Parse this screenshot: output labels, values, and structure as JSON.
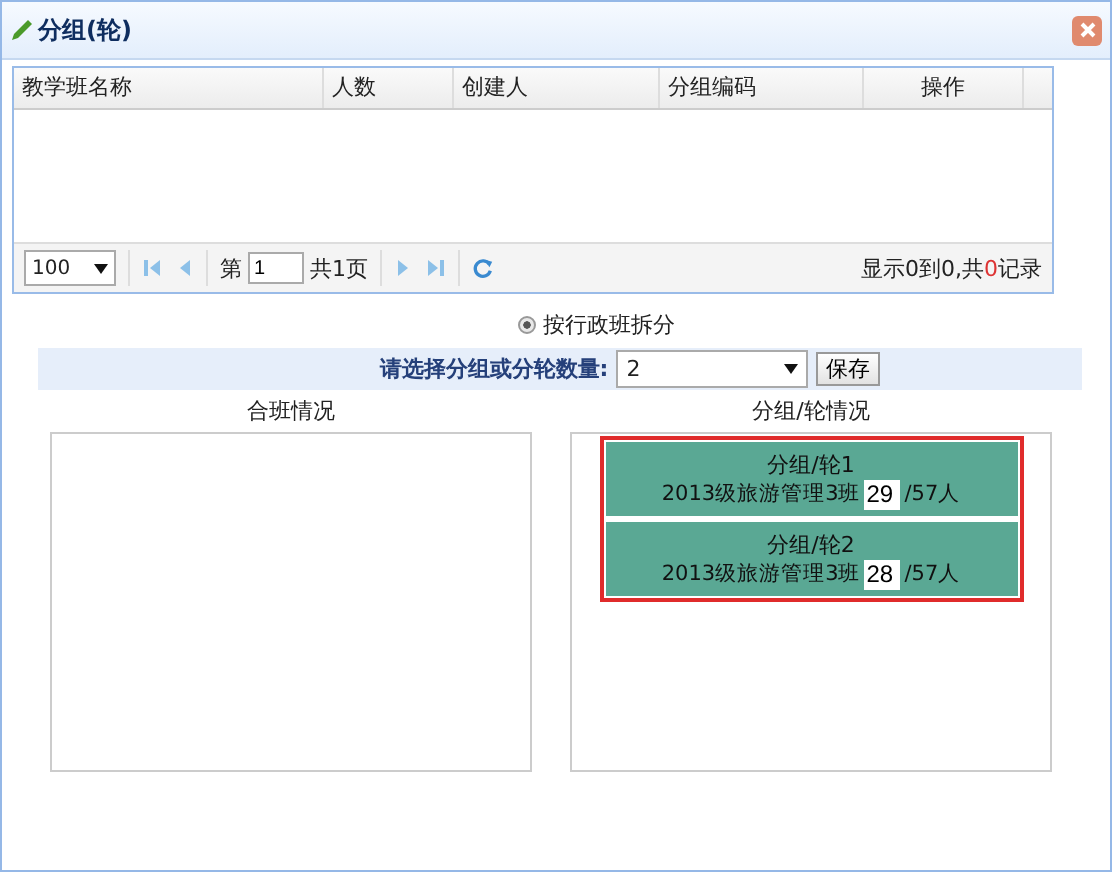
{
  "window": {
    "title": "分组(轮)"
  },
  "table": {
    "columns": [
      "教学班名称",
      "人数",
      "创建人",
      "分组编码",
      "操作"
    ]
  },
  "pager": {
    "page_size": "100",
    "page_prefix": "第",
    "page": "1",
    "page_suffix": "共1页",
    "status_prefix": "显示0到0,共",
    "status_count": "0",
    "status_suffix": "记录"
  },
  "split_mode": {
    "label": "按行政班拆分",
    "selected": true
  },
  "count_select": {
    "label": "请选择分组或分轮数量:",
    "value": "2",
    "save": "保存"
  },
  "left_panel": {
    "title": "合班情况"
  },
  "right_panel": {
    "title": "分组/轮情况",
    "groups": [
      {
        "name": "分组/轮1",
        "class": "2013级旅游管理3班",
        "value": "29",
        "total": "/57人"
      },
      {
        "name": "分组/轮2",
        "class": "2013级旅游管理3班",
        "value": "28",
        "total": "/57人"
      }
    ]
  }
}
